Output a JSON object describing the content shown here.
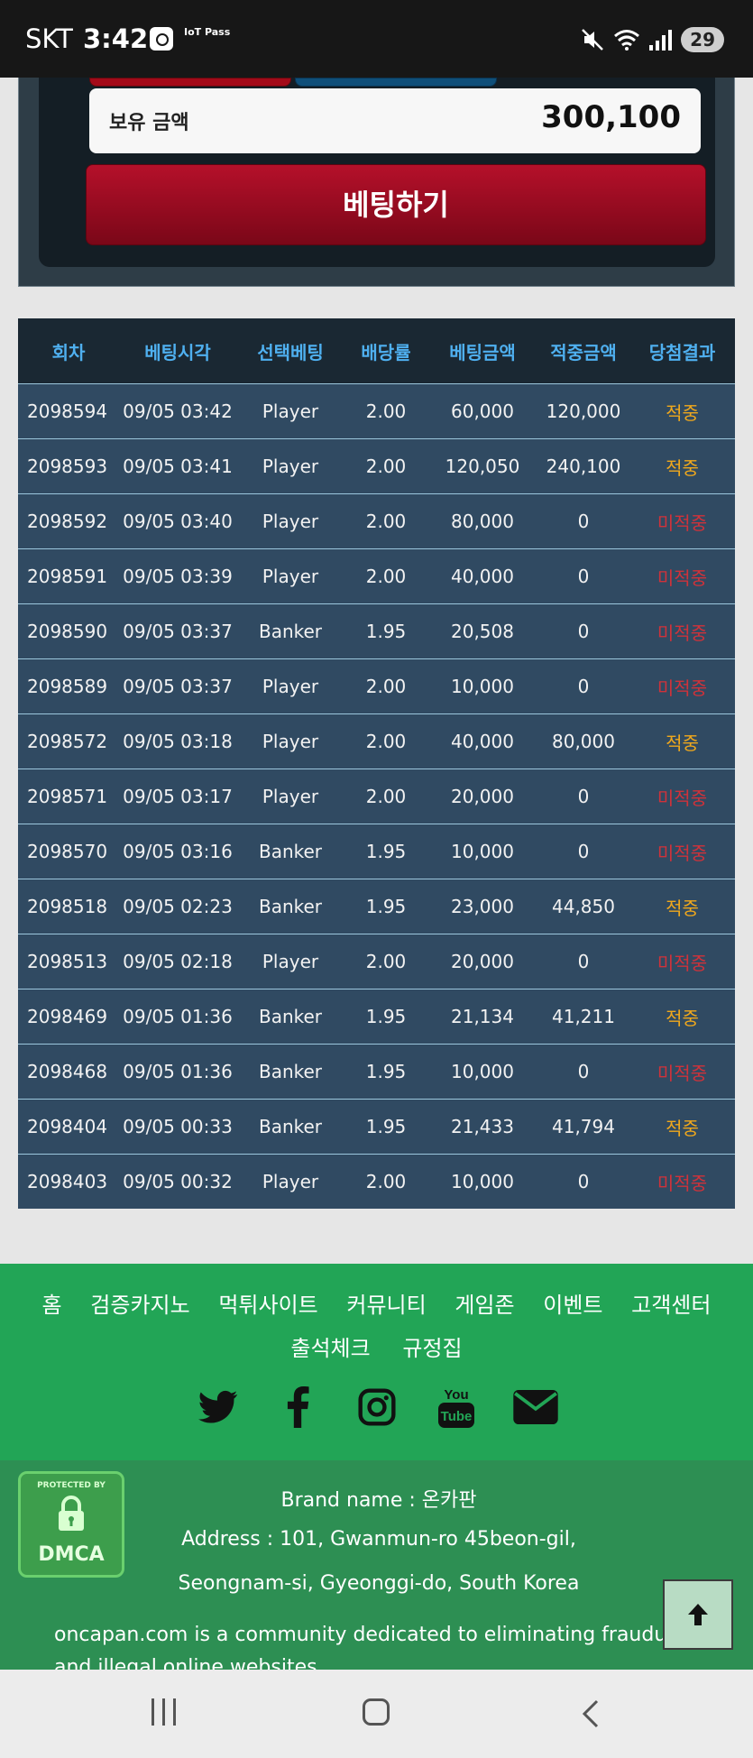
{
  "status_bar": {
    "carrier": "SKT",
    "time": "3:42",
    "app_badge": "IoT Pass",
    "battery": "29"
  },
  "bet_panel": {
    "balance_label": "보유 금액",
    "balance_value": "300,100",
    "bet_button": "베팅하기"
  },
  "history": {
    "columns": [
      "회차",
      "베팅시각",
      "선택베팅",
      "배당률",
      "베팅금액",
      "적중금액",
      "당첨결과"
    ],
    "rows": [
      {
        "round": "2098594",
        "time": "09/05 03:42",
        "choice": "Player",
        "odds": "2.00",
        "amount": "60,000",
        "payout": "120,000",
        "result": "적중",
        "win": true
      },
      {
        "round": "2098593",
        "time": "09/05 03:41",
        "choice": "Player",
        "odds": "2.00",
        "amount": "120,050",
        "payout": "240,100",
        "result": "적중",
        "win": true
      },
      {
        "round": "2098592",
        "time": "09/05 03:40",
        "choice": "Player",
        "odds": "2.00",
        "amount": "80,000",
        "payout": "0",
        "result": "미적중",
        "win": false
      },
      {
        "round": "2098591",
        "time": "09/05 03:39",
        "choice": "Player",
        "odds": "2.00",
        "amount": "40,000",
        "payout": "0",
        "result": "미적중",
        "win": false
      },
      {
        "round": "2098590",
        "time": "09/05 03:37",
        "choice": "Banker",
        "odds": "1.95",
        "amount": "20,508",
        "payout": "0",
        "result": "미적중",
        "win": false
      },
      {
        "round": "2098589",
        "time": "09/05 03:37",
        "choice": "Player",
        "odds": "2.00",
        "amount": "10,000",
        "payout": "0",
        "result": "미적중",
        "win": false
      },
      {
        "round": "2098572",
        "time": "09/05 03:18",
        "choice": "Player",
        "odds": "2.00",
        "amount": "40,000",
        "payout": "80,000",
        "result": "적중",
        "win": true
      },
      {
        "round": "2098571",
        "time": "09/05 03:17",
        "choice": "Player",
        "odds": "2.00",
        "amount": "20,000",
        "payout": "0",
        "result": "미적중",
        "win": false
      },
      {
        "round": "2098570",
        "time": "09/05 03:16",
        "choice": "Banker",
        "odds": "1.95",
        "amount": "10,000",
        "payout": "0",
        "result": "미적중",
        "win": false
      },
      {
        "round": "2098518",
        "time": "09/05 02:23",
        "choice": "Banker",
        "odds": "1.95",
        "amount": "23,000",
        "payout": "44,850",
        "result": "적중",
        "win": true
      },
      {
        "round": "2098513",
        "time": "09/05 02:18",
        "choice": "Player",
        "odds": "2.00",
        "amount": "20,000",
        "payout": "0",
        "result": "미적중",
        "win": false
      },
      {
        "round": "2098469",
        "time": "09/05 01:36",
        "choice": "Banker",
        "odds": "1.95",
        "amount": "21,134",
        "payout": "41,211",
        "result": "적중",
        "win": true
      },
      {
        "round": "2098468",
        "time": "09/05 01:36",
        "choice": "Banker",
        "odds": "1.95",
        "amount": "10,000",
        "payout": "0",
        "result": "미적중",
        "win": false
      },
      {
        "round": "2098404",
        "time": "09/05 00:33",
        "choice": "Banker",
        "odds": "1.95",
        "amount": "21,433",
        "payout": "41,794",
        "result": "적중",
        "win": true
      },
      {
        "round": "2098403",
        "time": "09/05 00:32",
        "choice": "Player",
        "odds": "2.00",
        "amount": "10,000",
        "payout": "0",
        "result": "미적중",
        "win": false
      }
    ]
  },
  "footer_nav": {
    "row1": [
      "홈",
      "검증카지노",
      "먹튀사이트",
      "커뮤니티",
      "게임존",
      "이벤트",
      "고객센터"
    ],
    "row2": [
      "출석체크",
      "규정집"
    ],
    "social_icons": [
      "twitter-icon",
      "facebook-icon",
      "instagram-icon",
      "youtube-icon",
      "mail-icon"
    ],
    "youtube_text_top": "You",
    "youtube_text_bottom": "Tube"
  },
  "info_footer": {
    "dmca_top": "PROTECTED BY",
    "dmca_text": "DMCA",
    "brand": "Brand name : 온카판",
    "address1": "Address : 101, Gwanmun-ro 45beon-gil,",
    "address2": "Seongnam-si, Gyeonggi-do, South Korea",
    "description": "oncapan.com is a community dedicated to eliminating fraudulent and illegal online websites"
  },
  "colors": {
    "win": "#f0a81c",
    "lose": "#d0323a",
    "footer_green": "#22a556",
    "header_blue": "#4fb0f0"
  }
}
